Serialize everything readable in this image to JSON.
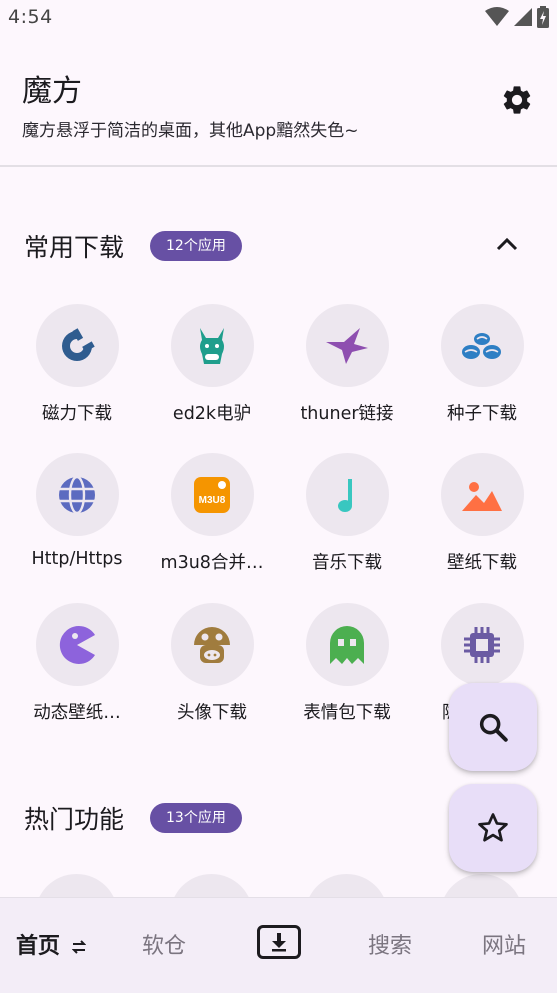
{
  "status_bar": {
    "time": "4:54"
  },
  "header": {
    "title": "魔方",
    "subtitle": "魔方悬浮于简洁的桌面，其他App黯然失色~"
  },
  "sections": [
    {
      "title": "常用下载",
      "badge": "12个应用",
      "apps": [
        {
          "label": "磁力下载",
          "icon": "magnet-icon",
          "color": "#2f5c8f"
        },
        {
          "label": "ed2k电驴",
          "icon": "donkey-icon",
          "color": "#1f9e8c"
        },
        {
          "label": "thuner链接",
          "icon": "bird-icon",
          "color": "#8e4fb0"
        },
        {
          "label": "种子下载",
          "icon": "seeds-icon",
          "color": "#2e7fc4"
        },
        {
          "label": "Http/Https",
          "icon": "globe-icon",
          "color": "#5c6bc0"
        },
        {
          "label": "m3u8合并…",
          "icon": "m3u8-icon",
          "color": "#f59500"
        },
        {
          "label": "音乐下载",
          "icon": "music-note-icon",
          "color": "#39c7c0"
        },
        {
          "label": "壁纸下载",
          "icon": "image-icon",
          "color": "#ff7043"
        },
        {
          "label": "动态壁纸…",
          "icon": "pacman-icon",
          "color": "#8d63dc"
        },
        {
          "label": "头像下载",
          "icon": "mushroom-icon",
          "color": "#a07c3e"
        },
        {
          "label": "表情包下载",
          "icon": "ghost-icon",
          "color": "#4caf50"
        },
        {
          "label": "隐…",
          "icon": "chip-icon",
          "color": "#6b5ba3"
        }
      ]
    },
    {
      "title": "热门功能",
      "badge": "13个应用"
    }
  ],
  "fabs": {
    "search": "search-icon",
    "favorite": "star-icon"
  },
  "bottom_nav": {
    "items": [
      "首页",
      "软仓",
      "搜索",
      "网站"
    ],
    "active": "首页"
  },
  "colors": {
    "accent": "#6750a4",
    "fab_bg": "#e8def8",
    "background": "#fdf7fd"
  }
}
